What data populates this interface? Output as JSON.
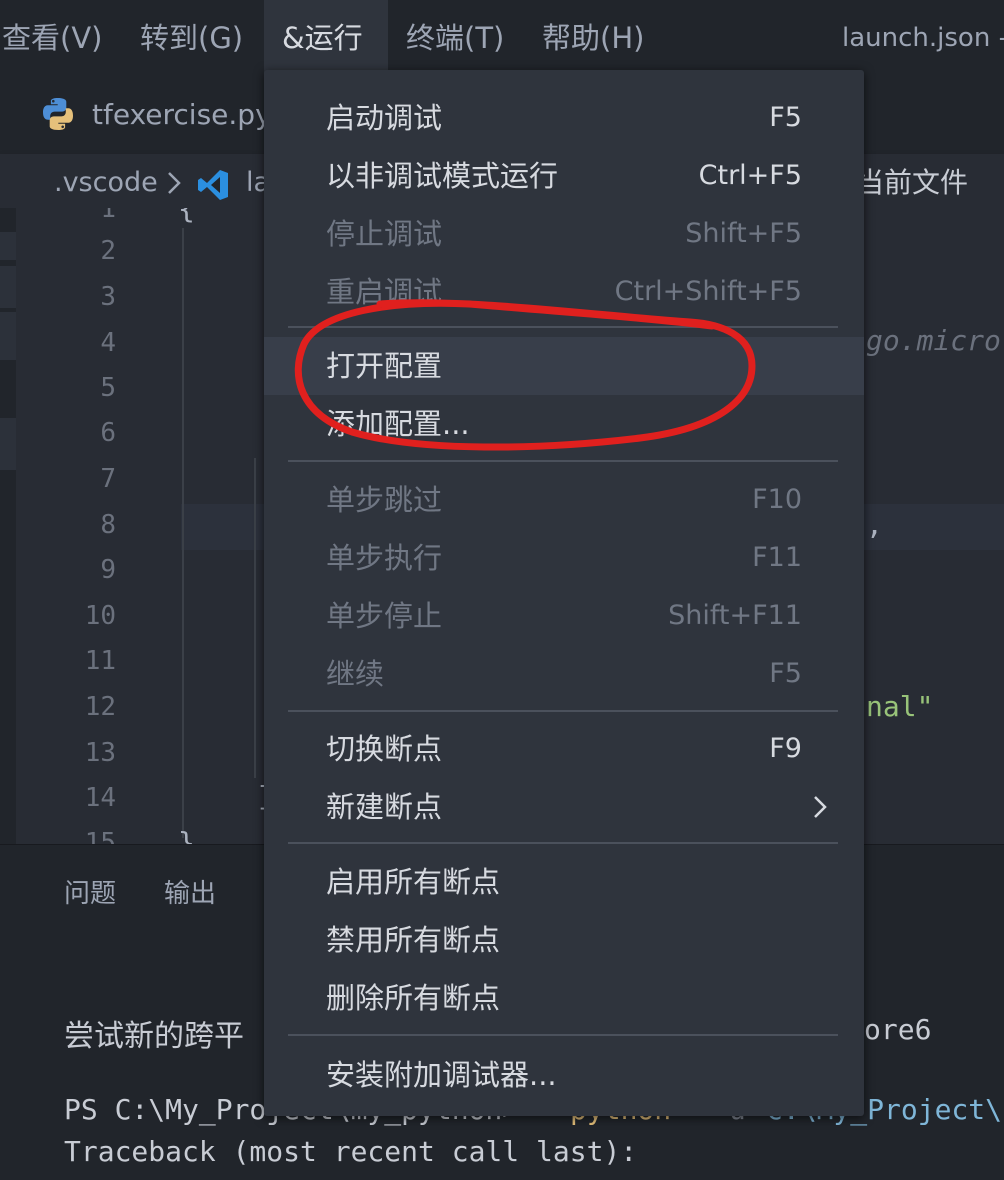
{
  "menubar": {
    "items": [
      "查看(V)",
      "转到(G)",
      "&运行",
      "终端(T)",
      "帮助(H)"
    ],
    "active_index": 2,
    "window_title": "launch.json -"
  },
  "tabs": [
    {
      "label": "tfexercise.py",
      "icon": "python-icon"
    }
  ],
  "breadcrumb": {
    "folder": ".vscode",
    "file_partial": "la",
    "file_icon": "vscode-icon",
    "right_text": "当前文件"
  },
  "editor": {
    "line_numbers": [
      "1",
      "2",
      "3",
      "4",
      "5",
      "6",
      "7",
      "8",
      "9",
      "10",
      "11",
      "12",
      "13",
      "14",
      "15"
    ],
    "visible_code_fragments": {
      "line1": "{",
      "line4_right": "go.micro",
      "line8_right": ",",
      "line12_right": "nal\"",
      "line14": "]",
      "line15": "}"
    }
  },
  "panel": {
    "tabs": [
      "问题",
      "输出"
    ],
    "terminal_lines": {
      "line1_left": "尝试新的跨平",
      "line1_right": "ore6",
      "line2_left": "PS C:\\My_Project\\my_python>",
      "line2_cmd": "python",
      "line2_flag": "-u",
      "line2_path": "c:\\My_Project\\",
      "line3": "Traceback (most recent call last):"
    }
  },
  "run_menu": {
    "groups": [
      [
        {
          "label": "启动调试",
          "shortcut": "F5",
          "enabled": true
        },
        {
          "label": "以非调试模式运行",
          "shortcut": "Ctrl+F5",
          "enabled": true
        },
        {
          "label": "停止调试",
          "shortcut": "Shift+F5",
          "enabled": false
        },
        {
          "label": "重启调试",
          "shortcut": "Ctrl+Shift+F5",
          "enabled": false
        }
      ],
      [
        {
          "label": "打开配置",
          "shortcut": "",
          "enabled": true,
          "hovered": true
        },
        {
          "label": "添加配置...",
          "shortcut": "",
          "enabled": true
        }
      ],
      [
        {
          "label": "单步跳过",
          "shortcut": "F10",
          "enabled": false
        },
        {
          "label": "单步执行",
          "shortcut": "F11",
          "enabled": false
        },
        {
          "label": "单步停止",
          "shortcut": "Shift+F11",
          "enabled": false
        },
        {
          "label": "继续",
          "shortcut": "F5",
          "enabled": false
        }
      ],
      [
        {
          "label": "切换断点",
          "shortcut": "F9",
          "enabled": true
        },
        {
          "label": "新建断点",
          "shortcut": "",
          "enabled": true,
          "submenu": true
        }
      ],
      [
        {
          "label": "启用所有断点",
          "shortcut": "",
          "enabled": true
        },
        {
          "label": "禁用所有断点",
          "shortcut": "",
          "enabled": true
        },
        {
          "label": "删除所有断点",
          "shortcut": "",
          "enabled": true
        }
      ],
      [
        {
          "label": "安装附加调试器...",
          "shortcut": "",
          "enabled": true
        }
      ]
    ]
  },
  "colors": {
    "menu_bg": "#2f343d",
    "editor_bg": "#282c34",
    "annotation_red": "#e0201e",
    "string_green": "#98c379",
    "python_yellow": "#e5c07b"
  }
}
